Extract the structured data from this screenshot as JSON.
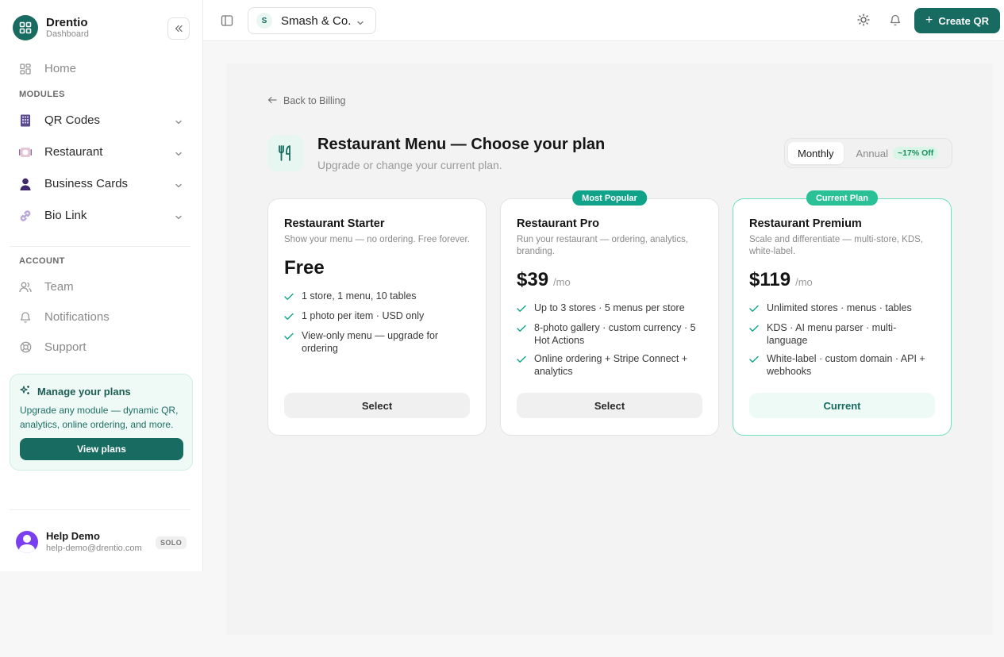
{
  "brand": {
    "name": "Drentio",
    "subtitle": "Dashboard"
  },
  "nav": {
    "home": "Home",
    "modules_label": "MODULES",
    "modules": [
      {
        "label": "QR Codes",
        "icon": "qr-building-icon"
      },
      {
        "label": "Restaurant",
        "icon": "restaurant-icon"
      },
      {
        "label": "Business Cards",
        "icon": "person-icon"
      },
      {
        "label": "Bio Link",
        "icon": "link-icon"
      }
    ],
    "account_label": "ACCOUNT",
    "account": [
      {
        "label": "Team",
        "icon": "team-icon"
      },
      {
        "label": "Notifications",
        "icon": "bell-icon"
      },
      {
        "label": "Support",
        "icon": "lifebuoy-icon"
      }
    ]
  },
  "promo": {
    "title": "Manage your plans",
    "text": "Upgrade any module — dynamic QR, analytics, online ordering, and more.",
    "button": "View plans"
  },
  "user": {
    "name": "Help Demo",
    "email": "help-demo@drentio.com",
    "badge": "SOLO"
  },
  "topbar": {
    "store_initial": "S",
    "store_name": "Smash & Co.",
    "create_label": "Create QR"
  },
  "page": {
    "back": "Back to Billing",
    "title": "Restaurant Menu — Choose your plan",
    "subtitle": "Upgrade or change your current plan."
  },
  "billing_toggle": {
    "monthly": "Monthly",
    "annual": "Annual",
    "discount": "~17% Off",
    "selected": "Monthly"
  },
  "plans": [
    {
      "name": "Restaurant Starter",
      "desc": "Show your menu — no ordering. Free forever.",
      "price": "Free",
      "period": "",
      "features": [
        "1 store, 1 menu, 10 tables",
        "1 photo per item · USD only",
        "View-only menu — upgrade for ordering"
      ],
      "button": "Select",
      "ribbon": ""
    },
    {
      "name": "Restaurant Pro",
      "desc": "Run your restaurant — ordering, analytics, branding.",
      "price": "$39",
      "period": "/mo",
      "features": [
        "Up to 3 stores · 5 menus per store",
        "8-photo gallery · custom currency · 5 Hot Actions",
        "Online ordering + Stripe Connect + analytics"
      ],
      "button": "Select",
      "ribbon": "Most Popular"
    },
    {
      "name": "Restaurant Premium",
      "desc": "Scale and differentiate — multi-store, KDS, white-label.",
      "price": "$119",
      "period": "/mo",
      "features": [
        "Unlimited stores · menus · tables",
        "KDS · AI menu parser · multi-language",
        "White-label · custom domain · API + webhooks"
      ],
      "button": "Current",
      "ribbon": "Current Plan"
    }
  ],
  "colors": {
    "brand": "#176b61",
    "accent": "#10a38a",
    "current": "#2bc196"
  }
}
